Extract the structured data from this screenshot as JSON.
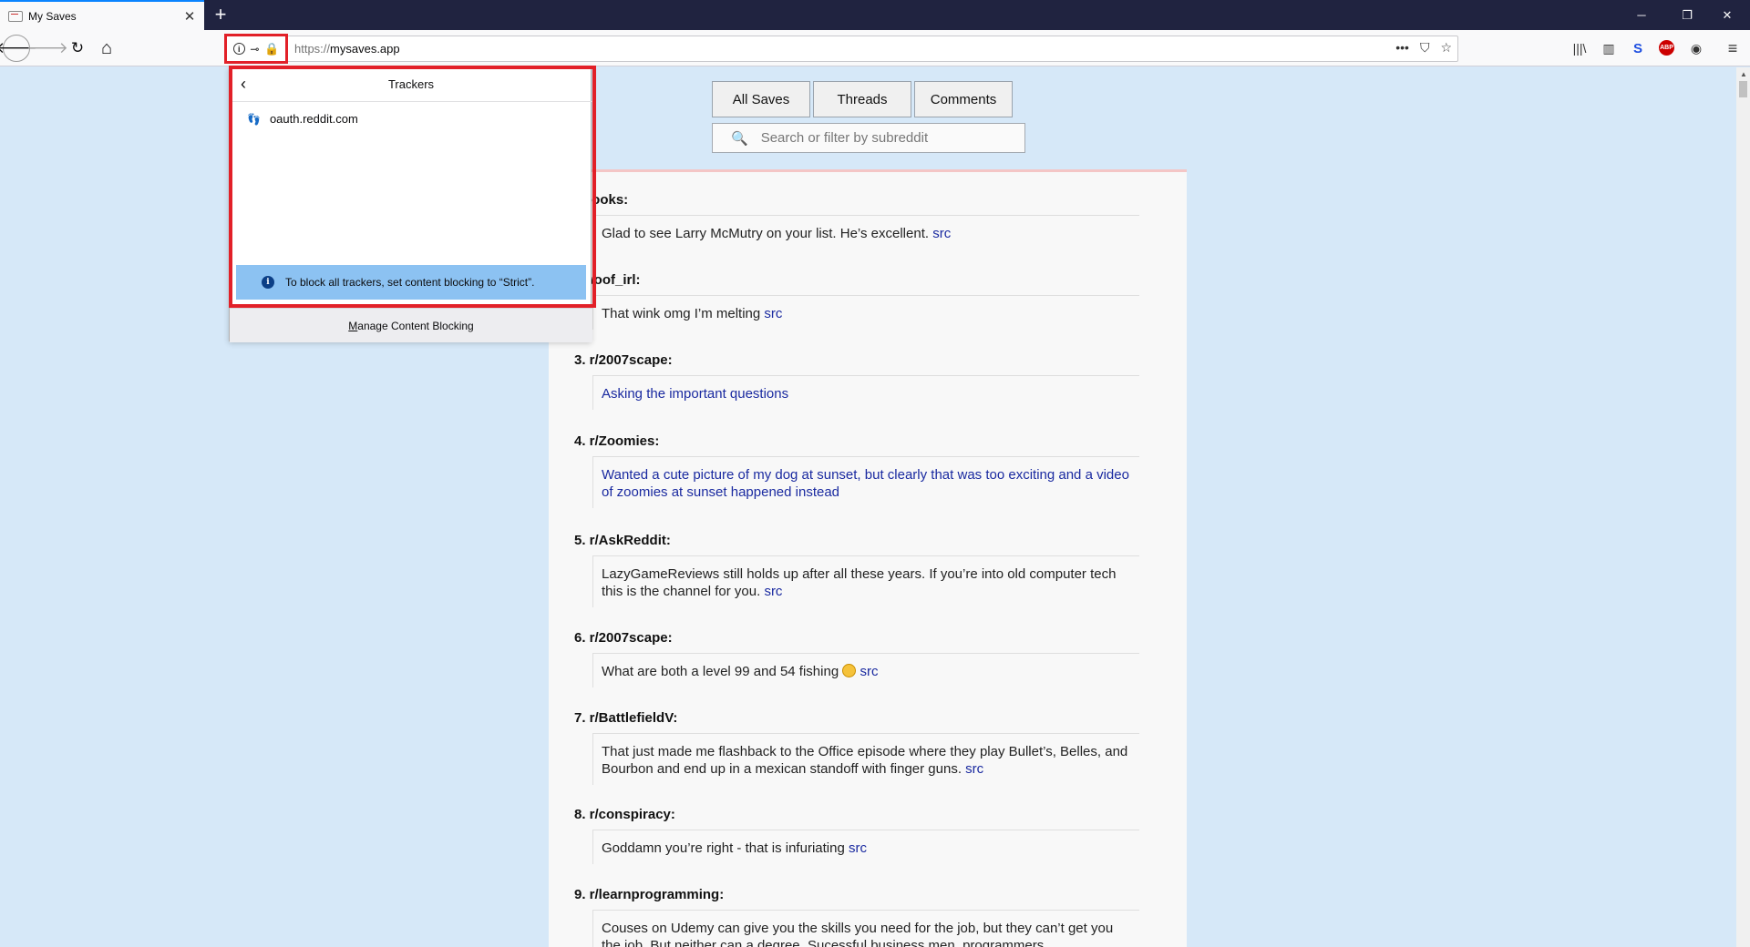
{
  "browser": {
    "tab_title": "My Saves",
    "tab_close": "✕",
    "new_tab": "+",
    "url_scheme": "https://",
    "url_host": "mysaves.app",
    "window_controls": [
      "─",
      "❐",
      "✕"
    ]
  },
  "icons": {
    "back": "🡐",
    "forward": "🡒",
    "reload": "↻",
    "home": "⌂",
    "info": "i",
    "key": "⊸",
    "lock": "🔒",
    "more": "•••",
    "pocket": "⛉",
    "star": "☆",
    "library": "|||\\",
    "sidebar": "▥",
    "s_ext": "S",
    "abp": "ABP",
    "account": "◉",
    "menu": "≡",
    "search": "🔍",
    "footprint": "👣",
    "popup_back": "‹"
  },
  "filters": {
    "buttons": [
      "All Saves",
      "Threads",
      "Comments"
    ],
    "search_placeholder": "Search or filter by subreddit"
  },
  "saves": [
    {
      "head": "r/books:",
      "text": "Glad to see Larry McMutry on your list. He’s excellent. ",
      "src": "src",
      "link": false
    },
    {
      "head": "r/woof_irl:",
      "text": "That wink omg I’m melting ",
      "src": "src",
      "link": false
    },
    {
      "head": "3. r/2007scape:",
      "text": "Asking the important questions",
      "src": "",
      "link": true
    },
    {
      "head": "4. r/Zoomies:",
      "text": "Wanted a cute picture of my dog at sunset, but clearly that was too exciting and a video of zoomies at sunset happened instead",
      "src": "",
      "link": true
    },
    {
      "head": "5. r/AskReddit:",
      "text": "LazyGameReviews still holds up after all these years. If you’re into old computer tech this is the channel for you. ",
      "src": "src",
      "link": false
    },
    {
      "head": "6. r/2007scape:",
      "text": "What are both a level 99 and 54 fishing ",
      "src": "src",
      "link": false,
      "emoji": true
    },
    {
      "head": "7. r/BattlefieldV:",
      "text": "That just made me flashback to the Office episode where they play Bullet’s, Belles, and Bourbon and end up in a mexican standoff with finger guns. ",
      "src": "src",
      "link": false
    },
    {
      "head": "8. r/conspiracy:",
      "text": "Goddamn you’re right - that is infuriating ",
      "src": "src",
      "link": false
    },
    {
      "head": "9. r/learnprogramming:",
      "text": "Couses on Udemy can give you the skills you need for the job, but they can’t get you the job. But neither can a degree. Sucessful business men, programmers",
      "src": "",
      "link": false
    }
  ],
  "popup": {
    "title": "Trackers",
    "trackers": [
      "oauth.reddit.com"
    ],
    "notice": "To block all trackers, set content blocking to “Strict”.",
    "footer_u": "M",
    "footer_rest": "anage Content Blocking"
  },
  "colors": {
    "highlight": "#e22028",
    "notice_bg": "#8cc2f2",
    "link": "#1a2aa0"
  }
}
